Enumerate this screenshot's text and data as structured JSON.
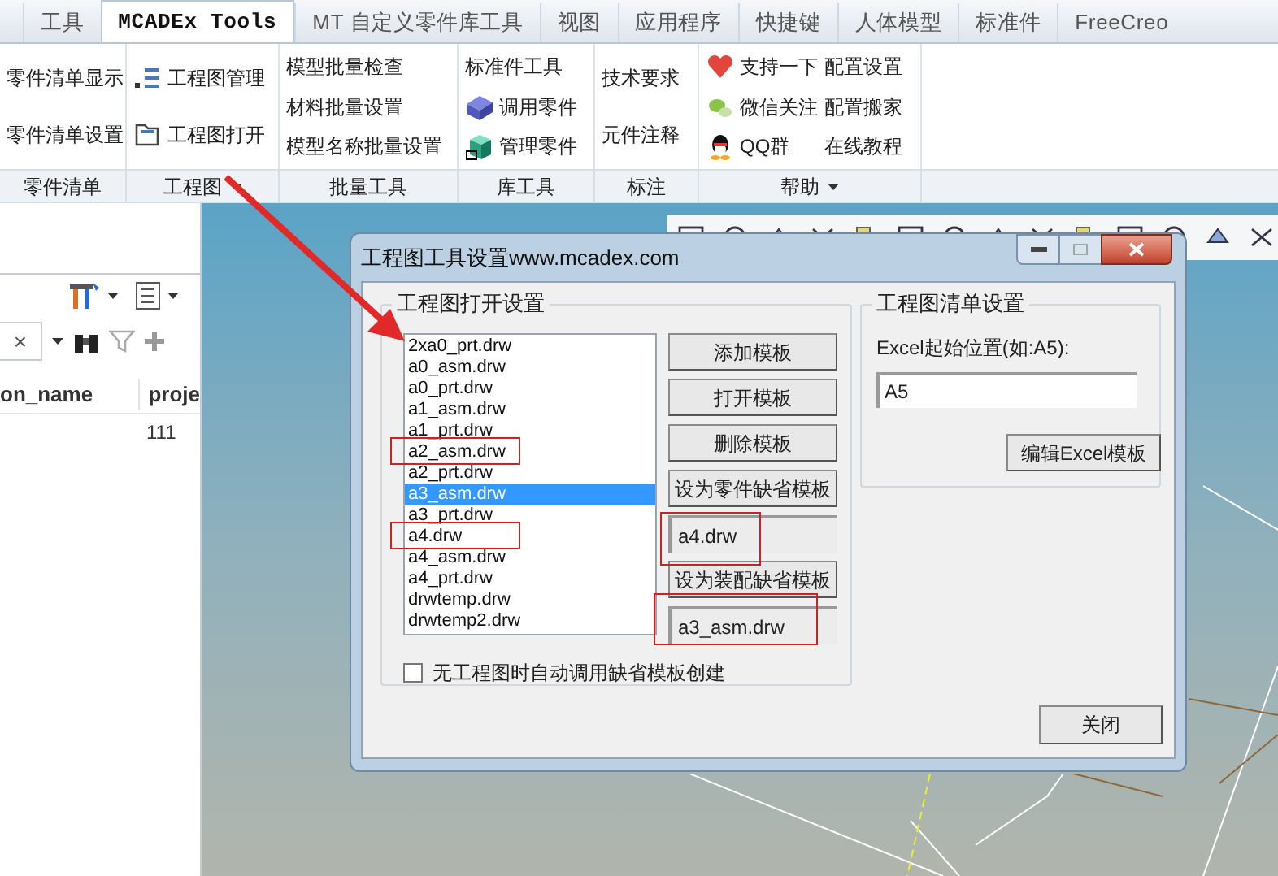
{
  "tabs": [
    {
      "label": "工具",
      "selected": false
    },
    {
      "label": "MCADEx Tools",
      "selected": true
    },
    {
      "label": "MT 自定义零件库工具",
      "selected": false
    },
    {
      "label": "视图",
      "selected": false
    },
    {
      "label": "应用程序",
      "selected": false
    },
    {
      "label": "快捷键",
      "selected": false
    },
    {
      "label": "人体模型",
      "selected": false
    },
    {
      "label": "标准件",
      "selected": false
    },
    {
      "label": "FreeCreo",
      "selected": false
    }
  ],
  "ribbon_groups": [
    {
      "label": "零件清单",
      "dropdown": false,
      "columns": [
        [
          "零件清单显示",
          "零件清单设置"
        ]
      ]
    },
    {
      "label": "工程图",
      "dropdown": true,
      "columns": [
        [
          "工程图管理",
          "工程图打开"
        ]
      ]
    },
    {
      "label": "批量工具",
      "dropdown": false,
      "columns": [
        [
          "模型批量检查",
          "材料批量设置",
          "模型名称批量设置"
        ]
      ]
    },
    {
      "label": "库工具",
      "dropdown": false,
      "columns": [
        [
          "标准件工具",
          "调用零件",
          "管理零件"
        ]
      ]
    },
    {
      "label": "标注",
      "dropdown": false,
      "columns": [
        [
          "技术要求",
          "元件注释"
        ]
      ]
    },
    {
      "label": "帮助",
      "dropdown": true,
      "columns": [
        [
          "支持一下",
          "微信关注",
          "QQ群"
        ],
        [
          "配置设置",
          "配置搬家",
          "在线教程"
        ]
      ]
    }
  ],
  "left_panel": {
    "clear_button": "×",
    "columns": [
      "on_name",
      "proje"
    ],
    "rows": [
      {
        "column_2": "111"
      }
    ]
  },
  "dialog": {
    "title": "工程图工具设置www.mcadex.com",
    "open_group": {
      "title": "工程图打开设置",
      "templates": [
        {
          "name": "2xa0_prt.drw",
          "selected": false,
          "annotated": false
        },
        {
          "name": "a0_asm.drw",
          "selected": false,
          "annotated": false
        },
        {
          "name": "a0_prt.drw",
          "selected": false,
          "annotated": false
        },
        {
          "name": "a1_asm.drw",
          "selected": false,
          "annotated": false
        },
        {
          "name": "a1_prt.drw",
          "selected": false,
          "annotated": false
        },
        {
          "name": "a2_asm.drw",
          "selected": false,
          "annotated": true
        },
        {
          "name": "a2_prt.drw",
          "selected": false,
          "annotated": false
        },
        {
          "name": "a3_asm.drw",
          "selected": true,
          "annotated": false
        },
        {
          "name": "a3_prt.drw",
          "selected": false,
          "annotated": false
        },
        {
          "name": "a4.drw",
          "selected": false,
          "annotated": true
        },
        {
          "name": "a4_asm.drw",
          "selected": false,
          "annotated": false
        },
        {
          "name": "a4_prt.drw",
          "selected": false,
          "annotated": false
        },
        {
          "name": "drwtemp.drw",
          "selected": false,
          "annotated": false
        },
        {
          "name": "drwtemp2.drw",
          "selected": false,
          "annotated": false
        }
      ],
      "controls": [
        {
          "kind": "button",
          "label": "添加模板"
        },
        {
          "kind": "button",
          "label": "打开模板"
        },
        {
          "kind": "button",
          "label": "删除模板"
        },
        {
          "kind": "button",
          "label": "设为零件缺省模板"
        },
        {
          "kind": "field",
          "value": "a4.drw",
          "annotated": true
        },
        {
          "kind": "button",
          "label": "设为装配缺省模板"
        },
        {
          "kind": "field",
          "value": "a3_asm.drw",
          "annotated": true
        }
      ],
      "checkbox": {
        "label": "无工程图时自动调用缺省模板创建",
        "checked": false
      }
    },
    "list_group": {
      "title": "工程图清单设置",
      "field_label": "Excel起始位置(如:A5):",
      "field_value": "A5",
      "button": "编辑Excel模板"
    },
    "close_button": "关闭"
  }
}
